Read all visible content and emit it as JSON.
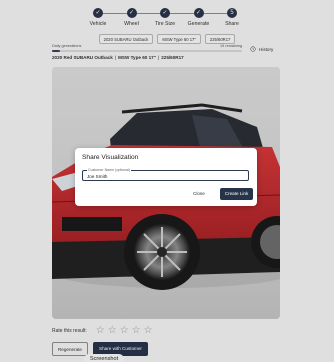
{
  "stepper": {
    "steps": [
      {
        "label": "Vehicle",
        "mark": "✓"
      },
      {
        "label": "Wheel",
        "mark": "✓"
      },
      {
        "label": "Tire Size",
        "mark": "✓"
      },
      {
        "label": "Generate",
        "mark": "✓"
      },
      {
        "label": "Share",
        "mark": "5"
      }
    ],
    "accent": "#2b3548"
  },
  "chips": [
    "2020 SUBARU Outback",
    "MSW Type 60 17\"",
    "225/60R17"
  ],
  "generations": {
    "label": "Daily generations",
    "remaining": "19 remaining",
    "used_fraction": 0.04
  },
  "history": {
    "label": "History",
    "icon": "history-icon"
  },
  "subheader": {
    "vehicle": "2020 Red SUBARU Outback",
    "wheel": "MSW Type 60 17\"",
    "tire": "225/60R17",
    "separator": "|"
  },
  "rating": {
    "label": "Rate this result:",
    "stars": [
      "☆",
      "☆",
      "☆",
      "☆",
      "☆"
    ]
  },
  "actions": {
    "regenerate": "Regenerate",
    "share_customer": "Share with Customer"
  },
  "tooltip": "Screenshot",
  "modal": {
    "title": "Share Visualization",
    "close_x": "×",
    "field_label": "Customer Name (optional)",
    "field_value": "Joe Smith",
    "close_button": "Close",
    "create_button": "Create Link"
  },
  "colors": {
    "primary_button": "#26344a",
    "car_body": "#c2282d",
    "background": "#f2f2f2"
  }
}
